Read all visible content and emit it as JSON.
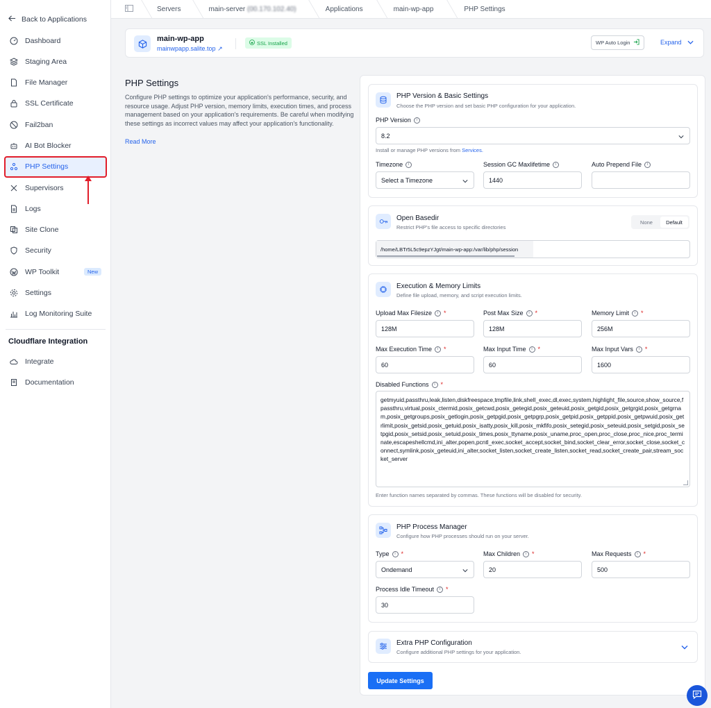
{
  "sidebar": {
    "back_label": "Back to Applications",
    "items": [
      {
        "label": "Dashboard"
      },
      {
        "label": "Staging Area"
      },
      {
        "label": "File Manager"
      },
      {
        "label": "SSL Certificate"
      },
      {
        "label": "Fail2ban"
      },
      {
        "label": "AI Bot Blocker"
      },
      {
        "label": "PHP Settings"
      },
      {
        "label": "Supervisors"
      },
      {
        "label": "Logs"
      },
      {
        "label": "Site Clone"
      },
      {
        "label": "Security"
      },
      {
        "label": "WP Toolkit",
        "badge": "New"
      },
      {
        "label": "Settings"
      },
      {
        "label": "Log Monitoring Suite"
      }
    ],
    "section_title": "Cloudflare Integration",
    "section_items": [
      {
        "label": "Integrate"
      },
      {
        "label": "Documentation"
      }
    ]
  },
  "breadcrumb": {
    "servers": "Servers",
    "server": "main-server",
    "server_ip": "(00.170.102.40)",
    "applications": "Applications",
    "app": "main-wp-app",
    "current": "PHP Settings"
  },
  "app_header": {
    "name": "main-wp-app",
    "url": "mainwpapp.salite.top",
    "ssl_badge": "SSL Installed",
    "wp_auto_login": "WP Auto Login",
    "expand": "Expand"
  },
  "page": {
    "title": "PHP Settings",
    "description": "Configure PHP settings to optimize your application's performance, security, and resource usage. Adjust PHP version, memory limits, execution times, and process management based on your application's requirements. Be careful when modifying these settings as incorrect values may affect your application's functionality.",
    "read_more": "Read More"
  },
  "version_card": {
    "title": "PHP Version & Basic Settings",
    "subtitle": "Choose the PHP version and set basic PHP configuration for your application.",
    "php_version_label": "PHP Version",
    "php_version_value": "8.2",
    "hint_prefix": "Install or manage PHP versions from",
    "hint_link": "Services.",
    "timezone_label": "Timezone",
    "timezone_value": "Select a Timezone",
    "gc_label": "Session GC Maxlifetime",
    "gc_value": "1440",
    "prepend_label": "Auto Prepend File",
    "prepend_value": ""
  },
  "basedir_card": {
    "title": "Open Basedir",
    "subtitle": "Restrict PHP's file access to specific directories",
    "opt_none": "None",
    "opt_default": "Default",
    "value": "/home/LBTr5L5c9epzYJgt/main-wp-app:/var/lib/php/session"
  },
  "limits_card": {
    "title": "Execution & Memory Limits",
    "subtitle": "Define file upload, memory, and script execution limits.",
    "upload_label": "Upload Max Filesize",
    "upload_value": "128M",
    "post_label": "Post Max Size",
    "post_value": "128M",
    "memory_label": "Memory Limit",
    "memory_value": "256M",
    "exec_label": "Max Execution Time",
    "exec_value": "60",
    "input_time_label": "Max Input Time",
    "input_time_value": "60",
    "input_vars_label": "Max Input Vars",
    "input_vars_value": "1600",
    "disabled_label": "Disabled Functions",
    "disabled_value": "getmyuid,passthru,leak,listen,diskfreespace,tmpfile,link,shell_exec,dl,exec,system,highlight_file,source,show_source,fpassthru,virtual,posix_ctermid,posix_getcwd,posix_getegid,posix_geteuid,posix_getgid,posix_getgrgid,posix_getgrnam,posix_getgroups,posix_getlogin,posix_getpgid,posix_getpgrp,posix_getpid,posix_getppid,posix_getpwuid,posix_getrlimit,posix_getsid,posix_getuid,posix_isatty,posix_kill,posix_mkfifo,posix_setegid,posix_seteuid,posix_setgid,posix_setpgid,posix_setsid,posix_setuid,posix_times,posix_ttyname,posix_uname,proc_open,proc_close,proc_nice,proc_terminate,escapeshellcmd,ini_alter,popen,pcntl_exec,socket_accept,socket_bind,socket_clear_error,socket_close,socket_connect,symlink,posix_geteuid,ini_alter,socket_listen,socket_create_listen,socket_read,socket_create_pair,stream_socket_server",
    "disabled_hint": "Enter function names separated by commas. These functions will be disabled for security."
  },
  "process_card": {
    "title": "PHP Process Manager",
    "subtitle": "Configure how PHP processes should run on your server.",
    "type_label": "Type",
    "type_value": "Ondemand",
    "children_label": "Max Children",
    "children_value": "20",
    "requests_label": "Max Requests",
    "requests_value": "500",
    "idle_label": "Process Idle Timeout",
    "idle_value": "30"
  },
  "extra_card": {
    "title": "Extra PHP Configuration",
    "subtitle": "Configure additional PHP settings for your application."
  },
  "update_button": "Update Settings",
  "colors": {
    "accent": "#1a6ff5",
    "link": "#2563eb",
    "required": "#dc2626",
    "ssl": "#16a34a",
    "highlight": "#e11d2a"
  }
}
